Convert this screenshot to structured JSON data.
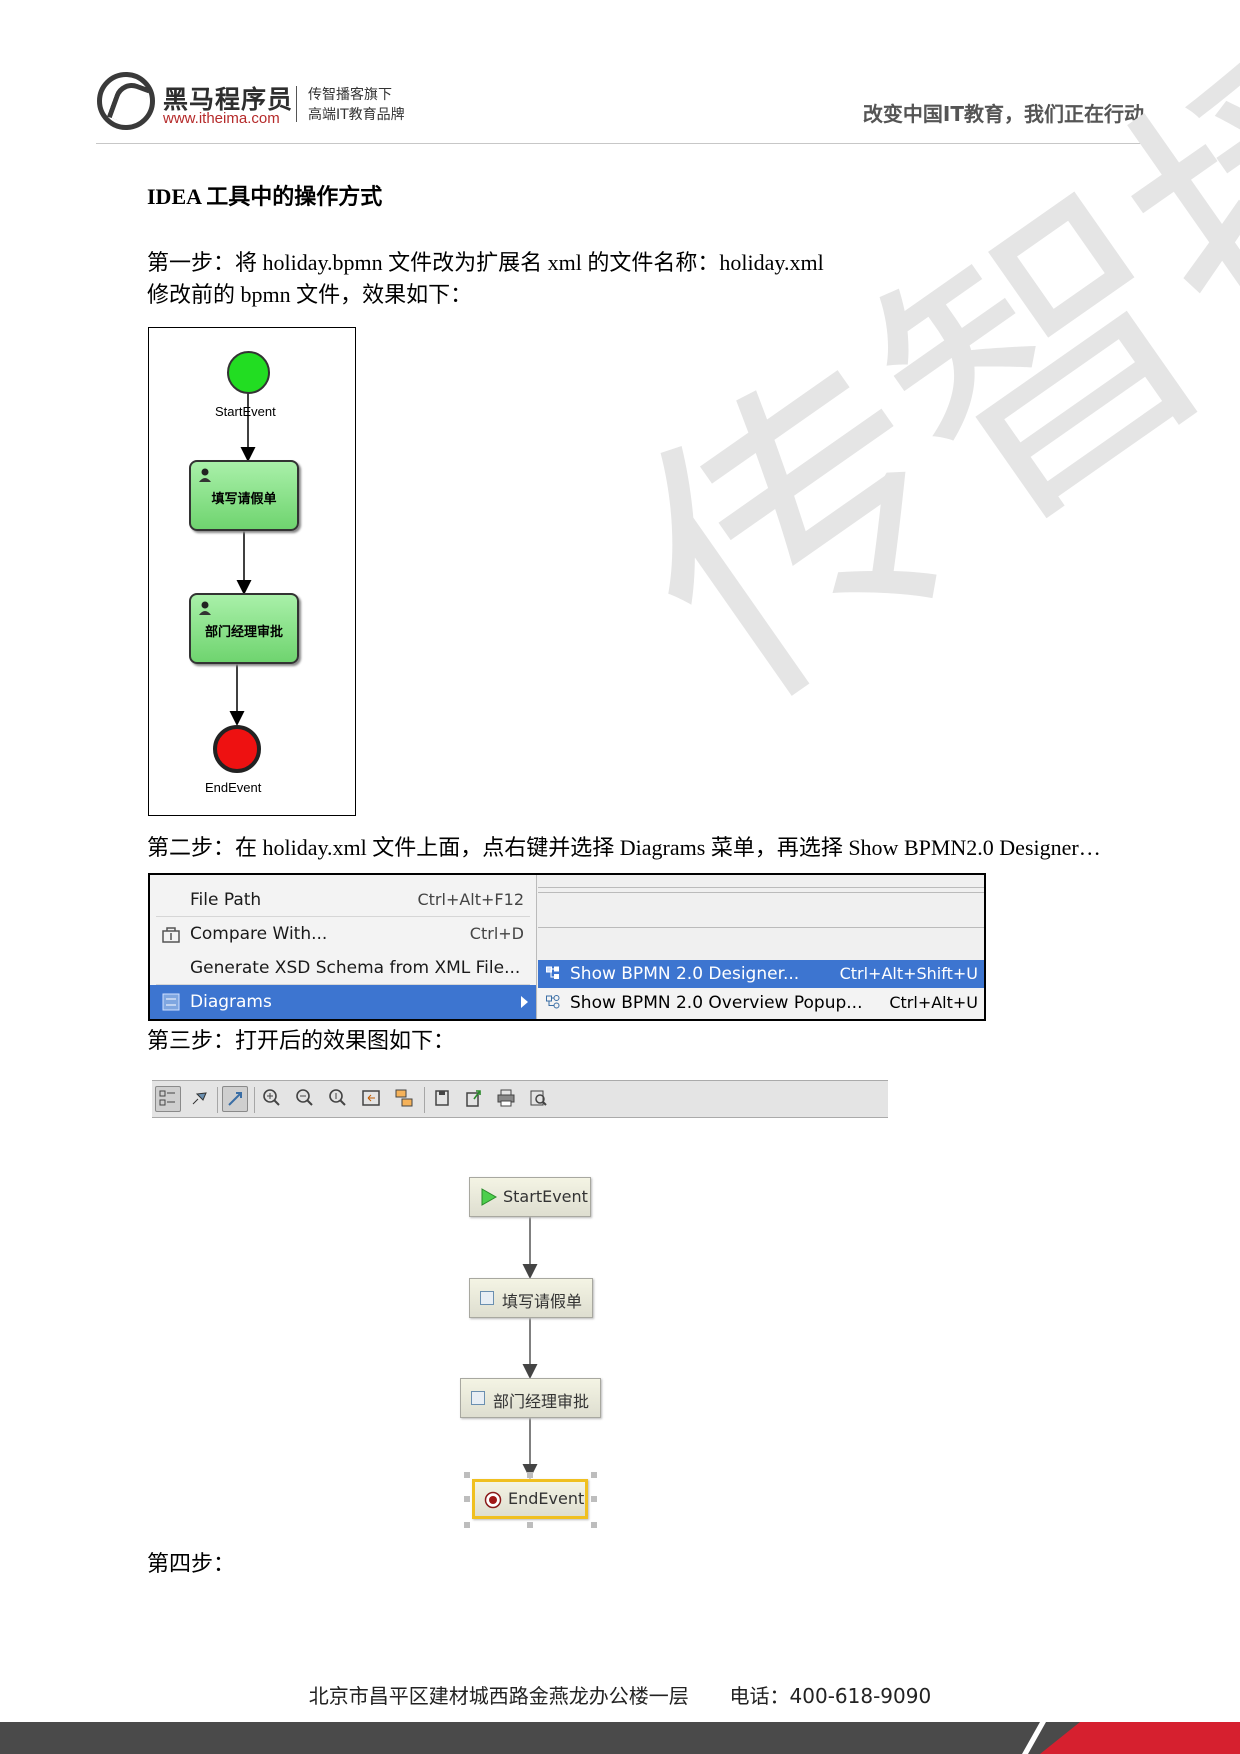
{
  "header": {
    "brand_cn": "黑马程序员",
    "brand_url": "www.itheima.com",
    "tagline_1": "传智播客旗下",
    "tagline_2": "高端IT教育品牌",
    "slogan": "改变中国IT教育，我们正在行动"
  },
  "watermark": "传智播客",
  "content": {
    "heading": "IDEA 工具中的操作方式",
    "step1": "第一步：将 holiday.bpmn 文件改为扩展名 xml 的文件名称：holiday.xml",
    "step1_note": "修改前的 bpmn 文件，效果如下：",
    "step2": "第二步：在 holiday.xml 文件上面，点右键并选择 Diagrams 菜单，再选择 Show BPMN2.0 Designer…",
    "step3": "第三步：打开后的效果图如下：",
    "step4": "第四步："
  },
  "figure1": {
    "start_label": "StartEvent",
    "task1_label": "填写请假单",
    "task2_label": "部门经理审批",
    "end_label": "EndEvent",
    "start_color": "#22dd22",
    "end_color": "#ee1111"
  },
  "context_menu": {
    "items": [
      {
        "label": "File Path",
        "shortcut": "Ctrl+Alt+F12"
      },
      {
        "label": "Compare With...",
        "shortcut": "Ctrl+D"
      },
      {
        "label": "Generate XSD Schema from XML File...",
        "shortcut": ""
      },
      {
        "label": "Diagrams",
        "shortcut": ""
      }
    ],
    "submenu": [
      {
        "label": "Show BPMN 2.0 Designer...",
        "shortcut": "Ctrl+Alt+Shift+U"
      },
      {
        "label": "Show BPMN 2.0 Overview Popup...",
        "shortcut": "Ctrl+Alt+U"
      }
    ],
    "selection_color": "#3d75d0"
  },
  "designer": {
    "toolbar_icons": [
      "structure-view-icon",
      "pin-icon",
      "select-mode-icon",
      "zoom-in-icon",
      "zoom-out-icon",
      "actual-size-icon",
      "fit-content-icon",
      "layout-icon",
      "save-icon",
      "export-icon",
      "print-icon",
      "print-preview-icon"
    ],
    "nodes": {
      "start": "StartEvent",
      "task1": "填写请假单",
      "task2": "部门经理审批",
      "end": "EndEvent"
    },
    "selected_border": "#f0c020"
  },
  "footer": {
    "address": "北京市昌平区建材城西路金燕龙办公楼一层",
    "phone": "电话：400-618-9090"
  }
}
